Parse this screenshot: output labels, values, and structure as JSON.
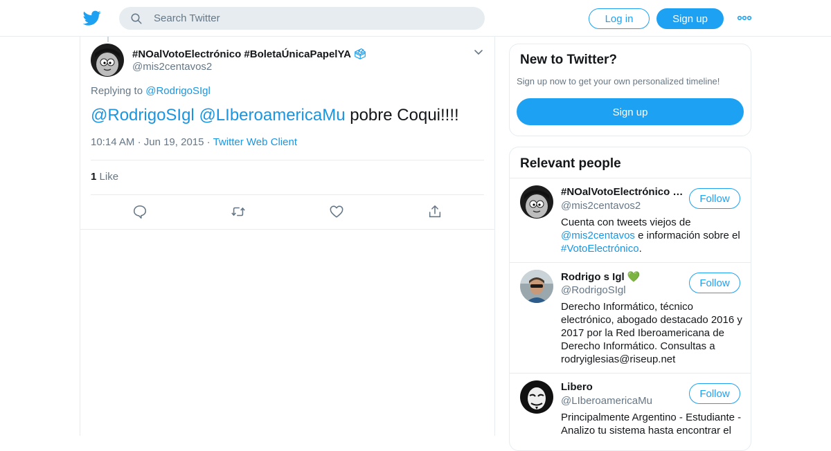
{
  "colors": {
    "accent": "#1da1f2",
    "link": "#1b95e0",
    "secondary_text": "#657786",
    "border": "#e6ecf0",
    "heart_emoji": "#6ab04c"
  },
  "header": {
    "logo_icon": "twitter-bird-icon",
    "search_placeholder": "Search Twitter",
    "login_label": "Log in",
    "signup_label": "Sign up",
    "more_icon": "more-dots-icon"
  },
  "tweet": {
    "author_name": "#NOalVotoElectrónico #BoletaÚnicaPapelYA",
    "author_emoji": "🗳",
    "author_handle": "@mis2centavos2",
    "replying_prefix": "Replying to",
    "replying_to": "@RodrigoSIgl",
    "text_mention_1": "@RodrigoSIgl",
    "text_mention_2": "@LIberoamericaMu",
    "text_body": "pobre Coqui!!!!",
    "time": "10:14 AM",
    "sep": "·",
    "date": "Jun 19, 2015",
    "client": "Twitter Web Client",
    "like_count": "1",
    "like_label": "Like"
  },
  "sidebar": {
    "new_card": {
      "title": "New to Twitter?",
      "subtitle": "Sign up now to get your own personalized timeline!",
      "button": "Sign up"
    },
    "relevant": {
      "title": "Relevant people",
      "follow_label": "Follow",
      "people": [
        {
          "name": "#NOalVotoElectrónico #...",
          "handle": "@mis2centavos2",
          "bio_pre": "Cuenta con tweets viejos de ",
          "bio_link1": "@mis2centavos",
          "bio_mid": " e información sobre el ",
          "bio_link2": "#VotoElectrónico",
          "bio_end": "."
        },
        {
          "name": "Rodrigo s Igl",
          "name_emoji": "💚",
          "handle": "@RodrigoSIgl",
          "bio": "Derecho Informático, técnico electrónico, abogado destacado 2016 y 2017 por la Red Iberoamericana de Derecho Informático. Consultas a rodryiglesias@riseup.net"
        },
        {
          "name": "Libero",
          "handle": "@LIberoamericaMu",
          "bio": "Principalmente Argentino - Estudiante - Analizo tu sistema hasta encontrar el"
        }
      ]
    }
  }
}
